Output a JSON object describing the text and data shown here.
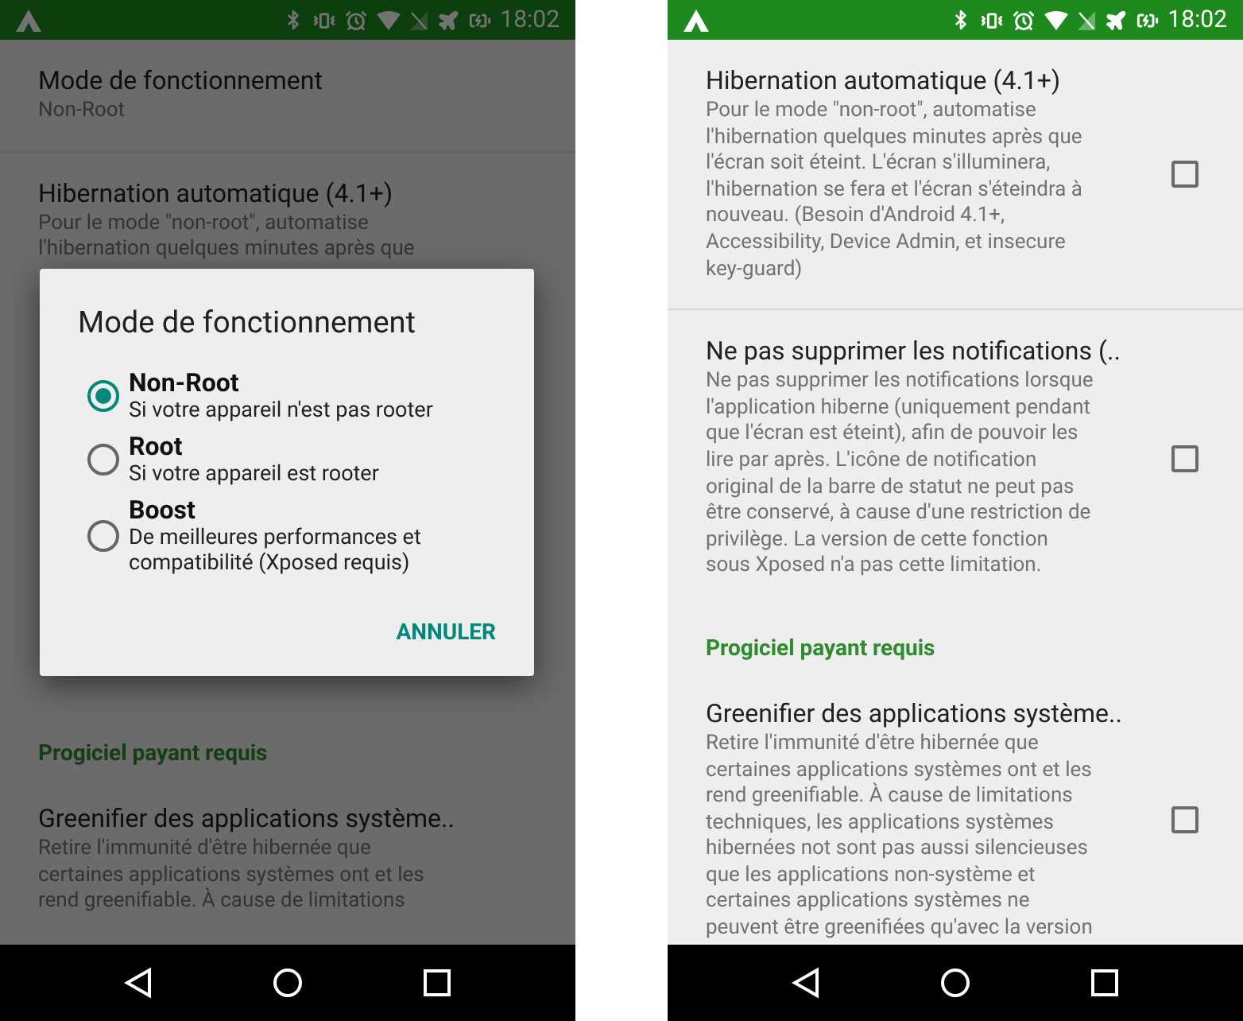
{
  "screens": [
    {
      "status_bar": {
        "time": "18:02"
      },
      "settings": [
        {
          "kind": "preference",
          "title": "Mode de fonctionnement",
          "summary": "Non-Root"
        },
        {
          "kind": "preference",
          "title": "Hibernation automatique (4.1+)",
          "summary": "Pour le mode \"non-root\", automatise\nl'hibernation quelques minutes après que"
        },
        {
          "kind": "category",
          "title": "Progiciel payant requis"
        },
        {
          "kind": "preference",
          "title": "Greenifier des applications système..",
          "summary": "Retire l'immunité d'être hibernée que\ncertaines applications systèmes ont et les\nrend greenifiable. À cause de limitations"
        }
      ],
      "dialog": {
        "title": "Mode de fonctionnement",
        "options": [
          {
            "label": "Non-Root",
            "description": "Si votre appareil n'est pas rooter",
            "selected": true
          },
          {
            "label": "Root",
            "description": "Si votre appareil est rooter",
            "selected": false
          },
          {
            "label": "Boost",
            "description": "De meilleures performances et\ncompatibilité (Xposed requis)",
            "selected": false
          }
        ],
        "button": "ANNULER"
      }
    },
    {
      "status_bar": {
        "time": "18:02"
      },
      "settings": [
        {
          "kind": "preference",
          "title": "Hibernation automatique (4.1+)",
          "summary": "Pour le mode \"non-root\", automatise\nl'hibernation quelques minutes après que\nl'écran soit éteint. L'écran s'illuminera,\nl'hibernation se fera et l'écran s'éteindra à\nnouveau. (Besoin d'Android 4.1+,\nAccessibility, Device Admin, et insecure\nkey-guard)",
          "checked": false
        },
        {
          "kind": "preference",
          "title": "Ne pas supprimer les notifications (..",
          "summary": "Ne pas supprimer les notifications lorsque\nl'application hiberne (uniquement pendant\nque l'écran est éteint), afin de pouvoir les\nlire par après. L'icône de notification\noriginal de la barre de statut ne peut pas\nêtre conservé, à cause d'une restriction de\nprivilège. La version de cette fonction\nsous Xposed n'a pas cette limitation.",
          "checked": false
        },
        {
          "kind": "category",
          "title": "Progiciel payant requis"
        },
        {
          "kind": "preference",
          "title": "Greenifier des applications système..",
          "summary": "Retire l'immunité d'être hibernée que\ncertaines applications systèmes ont et les\nrend greenifiable. À cause de limitations\ntechniques, les applications systèmes\nhibernées not sont pas aussi silencieuses\nque les applications non-système et\ncertaines applications systèmes ne\npeuvent être greenifiées qu'avec la version",
          "checked": false
        }
      ]
    }
  ]
}
